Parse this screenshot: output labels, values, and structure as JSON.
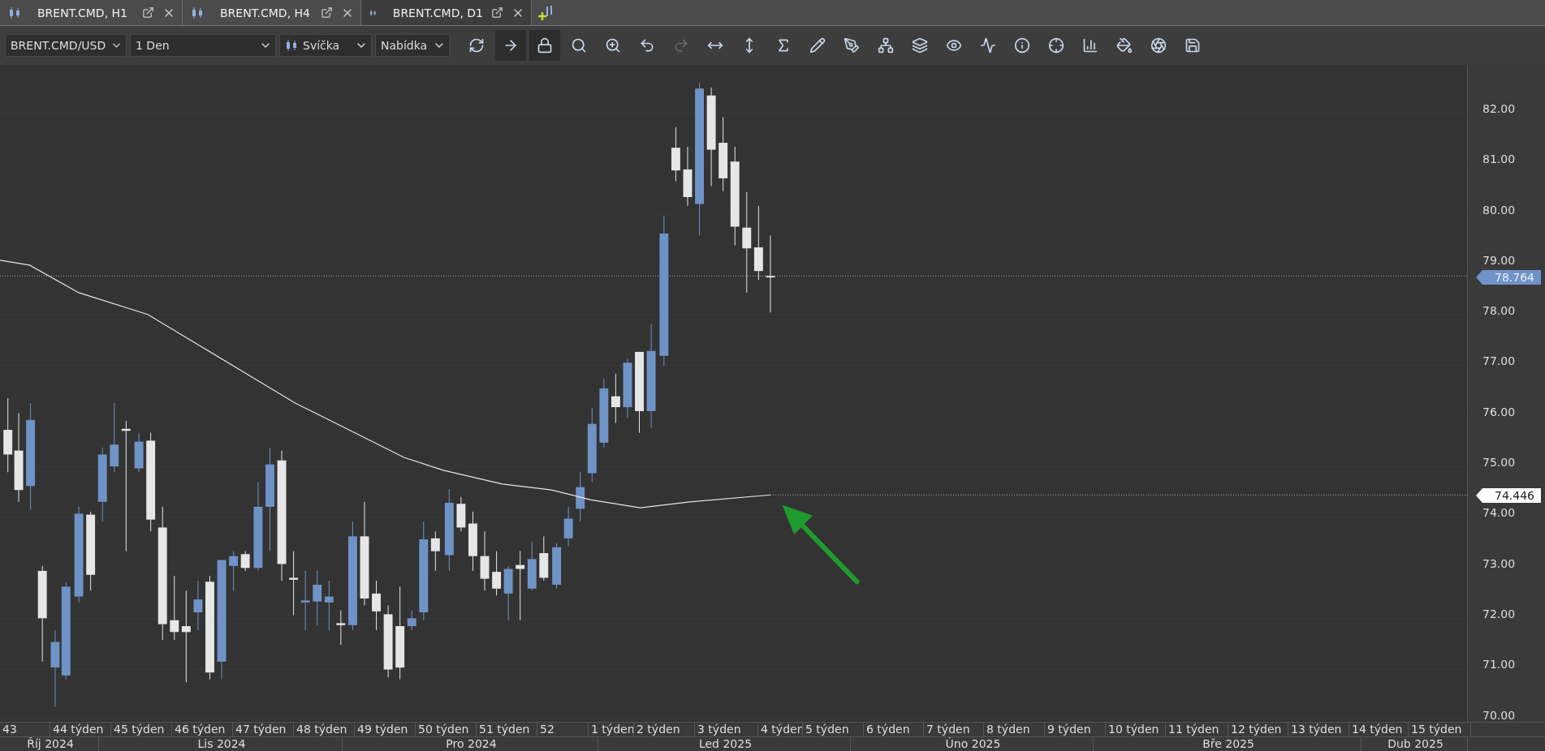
{
  "tabs": [
    {
      "label": "BRENT.CMD, H1",
      "selected": false
    },
    {
      "label": "BRENT.CMD, H4",
      "selected": false
    },
    {
      "label": "BRENT.CMD, D1",
      "selected": true
    }
  ],
  "toolbar": {
    "symbol": "BRENT.CMD/USD",
    "period": "1 Den",
    "chart_type": "Svíčka",
    "price_type": "Nabídka",
    "buttons": [
      {
        "selected": false,
        "disabled": false
      },
      {
        "selected": true,
        "disabled": false
      },
      {
        "selected": true,
        "disabled": false
      },
      {
        "selected": false,
        "disabled": false
      },
      {
        "selected": false,
        "disabled": false
      },
      {
        "selected": false,
        "disabled": false
      },
      {
        "selected": false,
        "disabled": true
      },
      {
        "selected": false,
        "disabled": false
      },
      {
        "selected": false,
        "disabled": false
      },
      {
        "selected": false,
        "disabled": false
      },
      {
        "selected": false,
        "disabled": false
      },
      {
        "selected": false,
        "disabled": false
      },
      {
        "selected": false,
        "disabled": false
      },
      {
        "selected": false,
        "disabled": false
      },
      {
        "selected": false,
        "disabled": false
      },
      {
        "selected": false,
        "disabled": false
      },
      {
        "selected": false,
        "disabled": false
      },
      {
        "selected": false,
        "disabled": false
      },
      {
        "selected": false,
        "disabled": false
      },
      {
        "selected": false,
        "disabled": false
      },
      {
        "selected": false,
        "disabled": false
      },
      {
        "selected": false,
        "disabled": false
      }
    ]
  },
  "price_axis": {
    "labels": [
      "82.00",
      "81.00",
      "80.00",
      "79.00",
      "78.00",
      "77.00",
      "76.00",
      "75.00",
      "74.00",
      "73.00",
      "72.00",
      "71.00",
      "70.00"
    ],
    "markers": [
      {
        "value": "78.764",
        "kind": "bid"
      },
      {
        "value": "74.446",
        "kind": "indicator"
      }
    ]
  },
  "time_axis": {
    "weeks": [
      "43",
      "44 týden",
      "45 týden",
      "46 týden",
      "47 týden",
      "48 týden",
      "49 týden",
      "50 týden",
      "51 týden",
      "52",
      "1 týden",
      "2 týden",
      "3 týden",
      "4 týden",
      "5 týden",
      "6 týden",
      "7 týden",
      "8 týden",
      "9 týden",
      "10 týden",
      "11 týden",
      "12 týden",
      "13 týden",
      "14 týden",
      "15 týden"
    ],
    "months": [
      "Říj 2024",
      "Lis 2024",
      "Pro 2024",
      "Led 2025",
      "Úno 2025",
      "Bře 2025",
      "Dub 2025"
    ]
  }
}
